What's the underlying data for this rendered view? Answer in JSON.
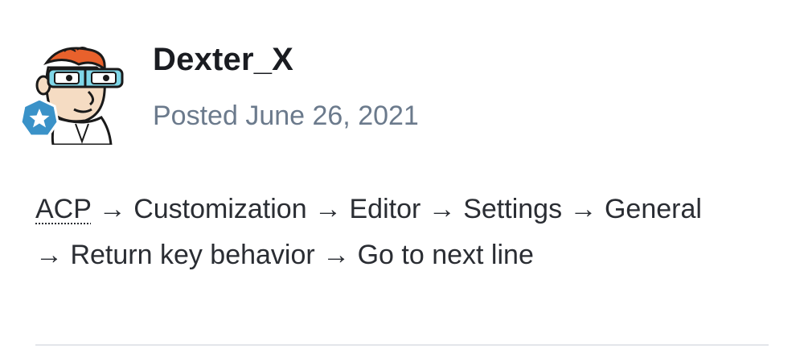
{
  "post": {
    "author": "Dexter_X",
    "posted_label": "Posted",
    "posted_date": "June 26, 2021",
    "content": {
      "abbreviation": "ACP",
      "line1_rest": " → Customization → Editor → Settings → General",
      "line2": "→ Return key behavior → Go to next line"
    },
    "avatar_icon": "dexter-cartoon-avatar",
    "badge_icon": "star-badge-icon",
    "colors": {
      "author": "#1a1c21",
      "meta": "#6b7a8c",
      "body_text": "#2a2d33",
      "badge": "#3a92c8",
      "divider": "#e3e6ea"
    }
  }
}
